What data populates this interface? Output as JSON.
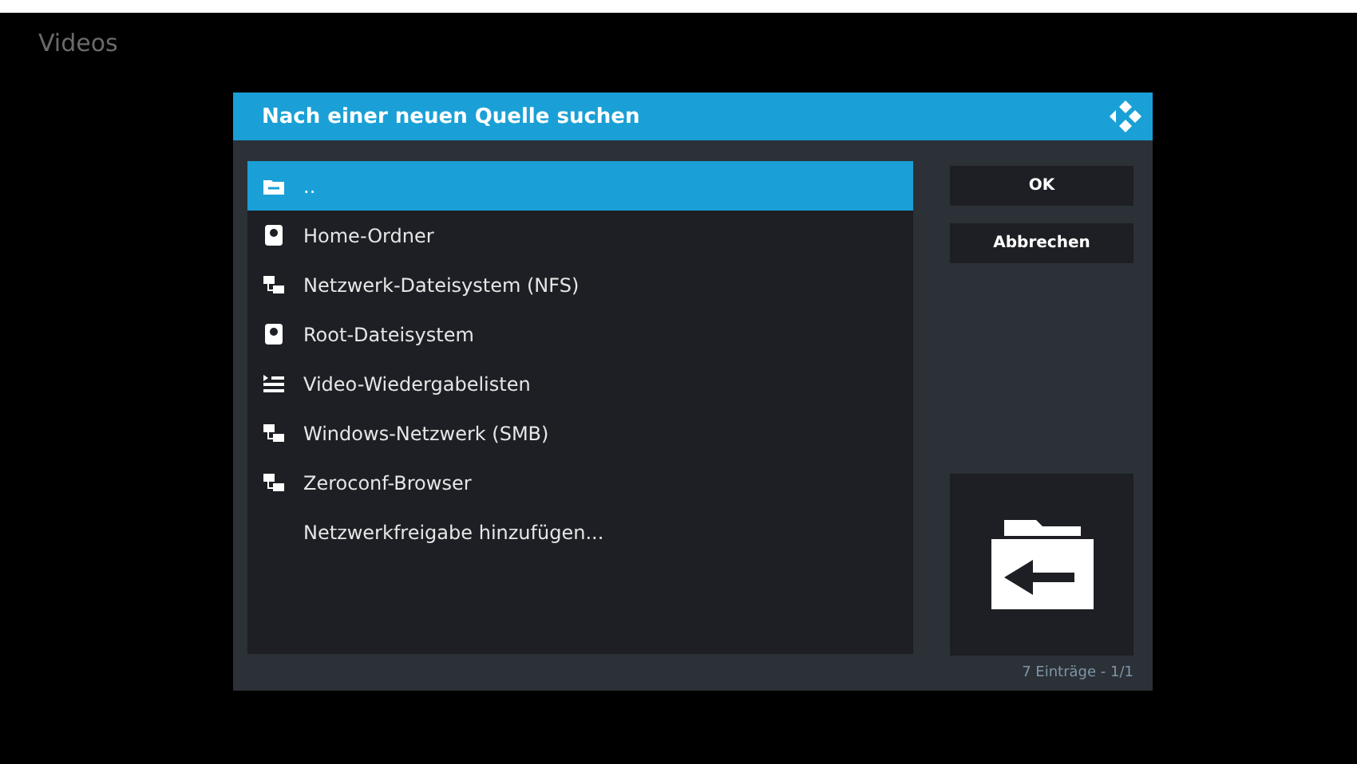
{
  "screen_title": "Videos",
  "dialog": {
    "title": "Nach einer neuen Quelle suchen",
    "items": [
      {
        "label": "..",
        "kind": "up",
        "selected": true
      },
      {
        "label": "Home-Ordner",
        "kind": "drive",
        "selected": false
      },
      {
        "label": "Netzwerk-Dateisystem (NFS)",
        "kind": "network",
        "selected": false
      },
      {
        "label": "Root-Dateisystem",
        "kind": "drive",
        "selected": false
      },
      {
        "label": "Video-Wiedergabelisten",
        "kind": "playlist",
        "selected": false
      },
      {
        "label": "Windows-Netzwerk (SMB)",
        "kind": "network",
        "selected": false
      },
      {
        "label": "Zeroconf-Browser",
        "kind": "network",
        "selected": false
      },
      {
        "label": "Netzwerkfreigabe hinzufügen...",
        "kind": "plain",
        "selected": false
      }
    ],
    "buttons": [
      "OK",
      "Abbrechen"
    ],
    "footer": "7 Einträge - 1/1"
  }
}
